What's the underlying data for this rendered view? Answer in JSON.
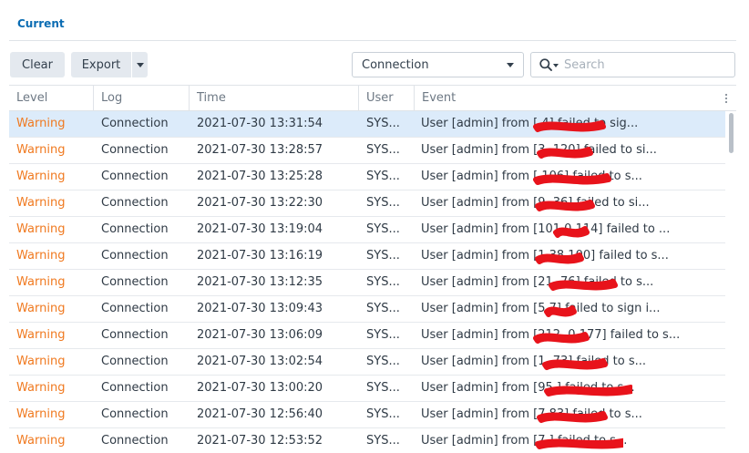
{
  "tabs": {
    "current": "Current"
  },
  "toolbar": {
    "clear": "Clear",
    "export": "Export"
  },
  "filter": {
    "selected": "Connection"
  },
  "search": {
    "placeholder": "Search"
  },
  "columns": {
    "level": "Level",
    "log": "Log",
    "time": "Time",
    "user": "User",
    "event": "Event"
  },
  "colors": {
    "accent": "#0a6cb3",
    "warning": "#f0791f",
    "selected_row": "#dcebfa",
    "redaction": "#e8131b"
  },
  "rows": [
    {
      "level": "Warning",
      "log": "Connection",
      "time": "2021-07-30 13:31:54",
      "user": "SYS...",
      "event": "User [admin] from [                    4] failed to sig..."
    },
    {
      "level": "Warning",
      "log": "Connection",
      "time": "2021-07-30 13:28:57",
      "user": "SYS...",
      "event": "User [admin] from [3              .120] failed to si..."
    },
    {
      "level": "Warning",
      "log": "Connection",
      "time": "2021-07-30 13:25:28",
      "user": "SYS...",
      "event": "User [admin] from [               106] failed to s..."
    },
    {
      "level": "Warning",
      "log": "Connection",
      "time": "2021-07-30 13:22:30",
      "user": "SYS...",
      "event": "User [admin] from [9            .36] failed to si..."
    },
    {
      "level": "Warning",
      "log": "Connection",
      "time": "2021-07-30 13:19:04",
      "user": "SYS...",
      "event": "User [admin] from [101          0.114] failed to ..."
    },
    {
      "level": "Warning",
      "log": "Connection",
      "time": "2021-07-30 13:16:19",
      "user": "SYS...",
      "event": "User [admin] from [1          38.100] failed to s..."
    },
    {
      "level": "Warning",
      "log": "Connection",
      "time": "2021-07-30 13:12:35",
      "user": "SYS...",
      "event": "User [admin] from [21             .76] failed to s..."
    },
    {
      "level": "Warning",
      "log": "Connection",
      "time": "2021-07-30 13:09:43",
      "user": "SYS...",
      "event": "User [admin] from [5           7] failed to sign i..."
    },
    {
      "level": "Warning",
      "log": "Connection",
      "time": "2021-07-30 13:06:09",
      "user": "SYS...",
      "event": "User [admin] from [212.       0.177] failed to s..."
    },
    {
      "level": "Warning",
      "log": "Connection",
      "time": "2021-07-30 13:02:54",
      "user": "SYS...",
      "event": "User [admin] from [1             .73] failed to s..."
    },
    {
      "level": "Warning",
      "log": "Connection",
      "time": "2021-07-30 13:00:20",
      "user": "SYS...",
      "event": "User [admin] from [95                ] failed to s..."
    },
    {
      "level": "Warning",
      "log": "Connection",
      "time": "2021-07-30 12:56:40",
      "user": "SYS...",
      "event": "User [admin] from [7             83] failed to s..."
    },
    {
      "level": "Warning",
      "log": "Connection",
      "time": "2021-07-30 12:53:52",
      "user": "SYS...",
      "event": "User [admin] from [7               ] failed to s..."
    }
  ]
}
